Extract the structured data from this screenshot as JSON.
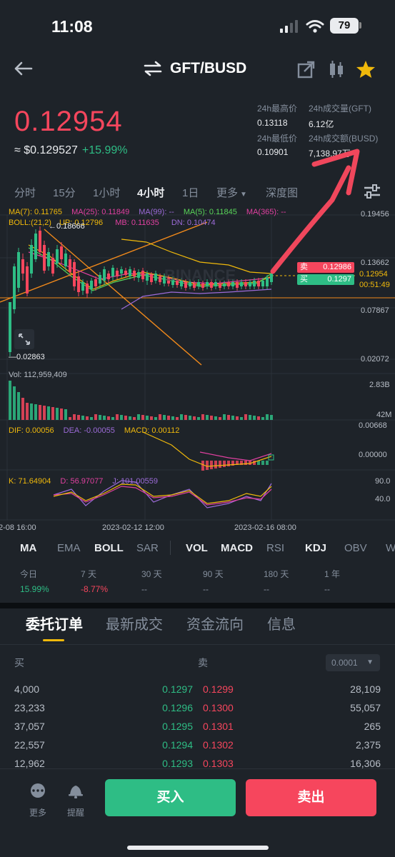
{
  "status_bar": {
    "time": "11:08",
    "battery": "79"
  },
  "header": {
    "pair": "GFT/BUSD"
  },
  "price": {
    "last": "0.12954",
    "fiat": "≈ $0.129527",
    "change_pct": "+15.99%"
  },
  "stats": {
    "high_label": "24h最高价",
    "high_value": "0.13118",
    "vol_gft_label": "24h成交量(GFT)",
    "vol_gft_value": "6.12亿",
    "low_label": "24h最低价",
    "low_value": "0.10901",
    "vol_busd_label": "24h成交额(BUSD)",
    "vol_busd_value": "7,138.97万"
  },
  "timeframes": [
    "分时",
    "15分",
    "1小时",
    "4小时",
    "1日",
    "更多",
    "深度图"
  ],
  "timeframe_active": "4小时",
  "chart": {
    "ma_legend": {
      "ma7": "MA(7): 0.11765",
      "ma25": "MA(25): 0.11849",
      "ma99": "MA(99): --",
      "ma5": "MA(5): 0.11845",
      "ma365": "MA(365): --"
    },
    "boll_legend": {
      "boll": "BOLL:(21,2)",
      "up": "UP: 0.12796",
      "mb": "MB: 0.11635",
      "dn": "DN: 0.10474"
    },
    "price_axis": [
      "0.19456",
      "0.13662",
      "0.12954",
      "0.07867",
      "0.02072"
    ],
    "countdown": "00:51:49",
    "ask_label": "卖",
    "ask_value": "0.12986",
    "bid_label": "买",
    "bid_value": "0.1297",
    "high_marker": "0.18666",
    "low_marker": "0.02863",
    "watermark": "BINANCE",
    "vol_legend": "Vol: 112,959,409",
    "vol_axis": [
      "2.83B",
      "42M"
    ],
    "macd_legend": {
      "dif": "DIF: 0.00056",
      "dea": "DEA: -0.00055",
      "macd": "MACD: 0.00112"
    },
    "macd_axis": [
      "0.00668",
      "0.00000"
    ],
    "kdj_legend": {
      "k": "K: 71.64904",
      "d": "D: 56.97077",
      "j": "J: 101.00559"
    },
    "kdj_axis": [
      "90.0",
      "40.0"
    ],
    "time_axis": [
      "2-08 16:00",
      "2023-02-12 12:00",
      "2023-02-16 08:00"
    ],
    "colors": {
      "up": "#2ebd85",
      "down": "#f6465d",
      "ma7": "#f0b90b",
      "ma25": "#e040a0",
      "ma99": "#9c6bd8",
      "ma5": "#59d659",
      "accent": "#f0b90b"
    }
  },
  "indicators": [
    "MA",
    "EMA",
    "BOLL",
    "SAR",
    "VOL",
    "MACD",
    "RSI",
    "KDJ",
    "OBV",
    "W"
  ],
  "indicators_active": [
    "MA",
    "BOLL",
    "VOL",
    "MACD",
    "KDJ"
  ],
  "performance": [
    {
      "label": "今日",
      "value": "15.99%"
    },
    {
      "label": "7 天",
      "value": "-8.77%"
    },
    {
      "label": "30 天",
      "value": "--"
    },
    {
      "label": "90 天",
      "value": "--"
    },
    {
      "label": "180 天",
      "value": "--"
    },
    {
      "label": "1 年",
      "value": "--"
    }
  ],
  "section_tabs": [
    "委托订单",
    "最新成交",
    "资金流向",
    "信息"
  ],
  "orderbook": {
    "buy_label": "买",
    "sell_label": "卖",
    "precision": "0.0001",
    "rows": [
      {
        "bid_qty": "4,000",
        "bid_price": "0.1297",
        "ask_price": "0.1299",
        "ask_qty": "28,109"
      },
      {
        "bid_qty": "23,233",
        "bid_price": "0.1296",
        "ask_price": "0.1300",
        "ask_qty": "55,057"
      },
      {
        "bid_qty": "37,057",
        "bid_price": "0.1295",
        "ask_price": "0.1301",
        "ask_qty": "265"
      },
      {
        "bid_qty": "22,557",
        "bid_price": "0.1294",
        "ask_price": "0.1302",
        "ask_qty": "2,375"
      },
      {
        "bid_qty": "12,962",
        "bid_price": "0.1293",
        "ask_price": "0.1303",
        "ask_qty": "16,306"
      }
    ]
  },
  "bottom_bar": {
    "more_label": "更多",
    "alert_label": "提醒",
    "buy_button": "买入",
    "sell_button": "卖出"
  }
}
